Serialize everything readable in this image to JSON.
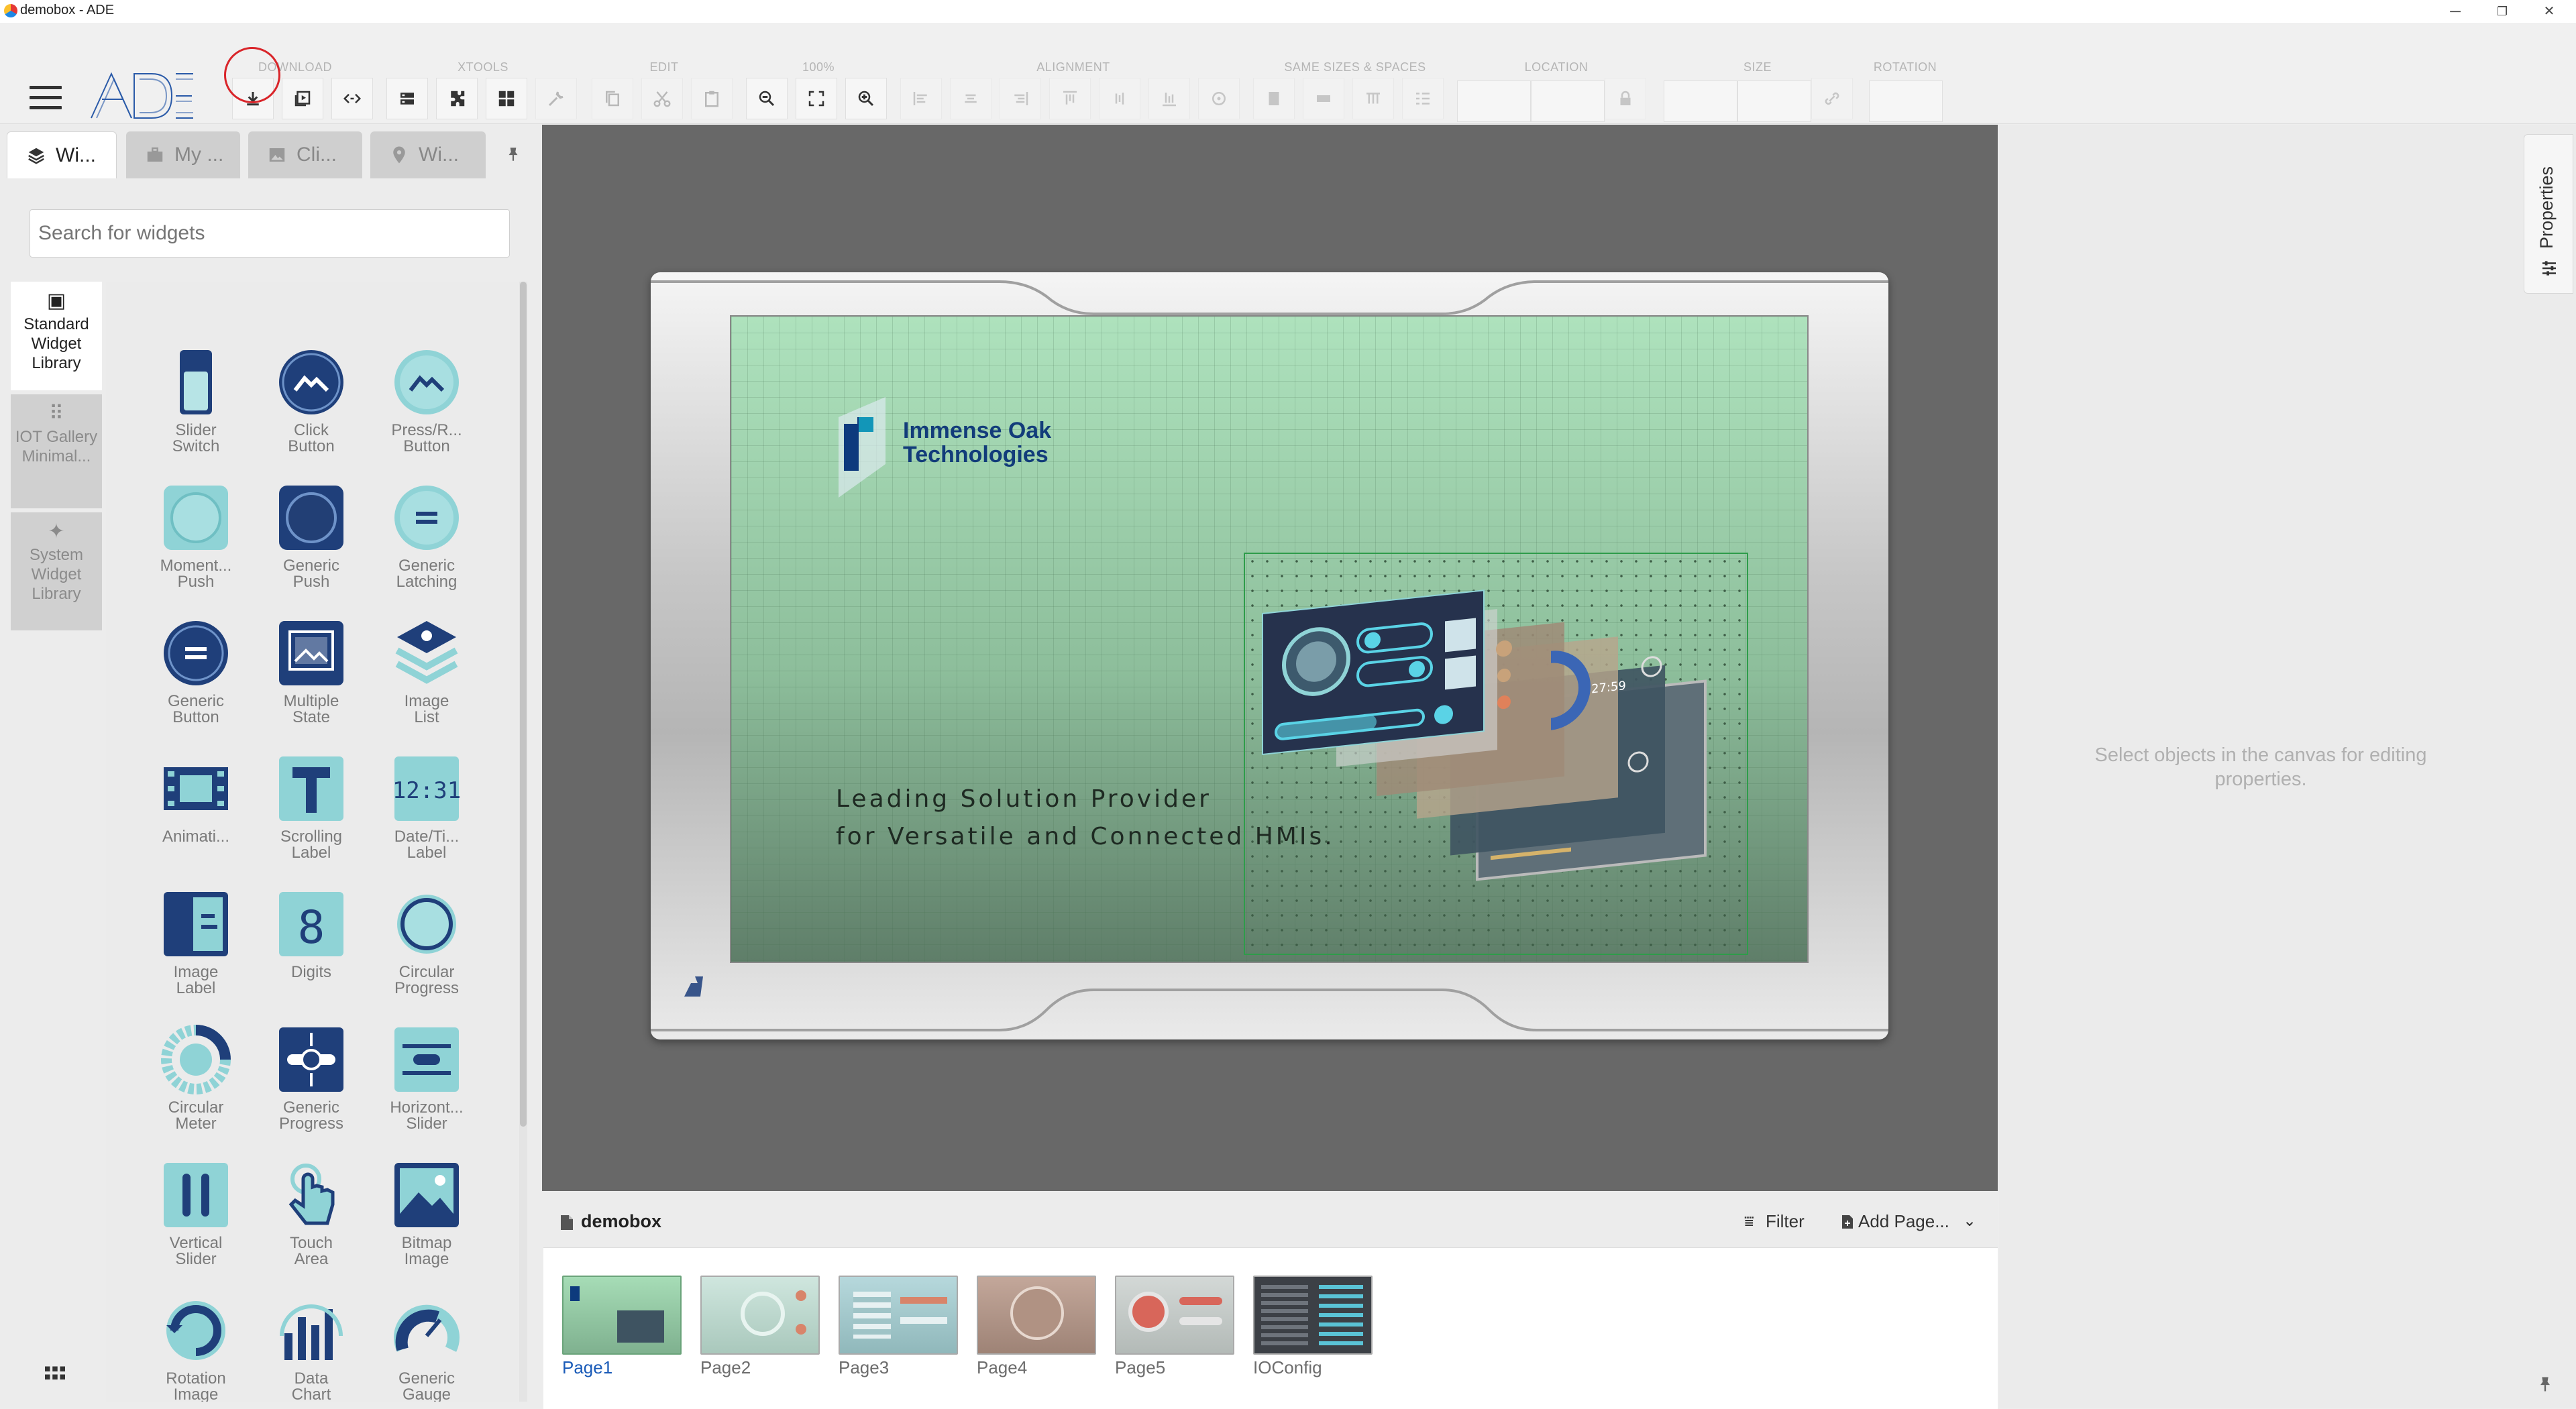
{
  "window": {
    "title": "demobox - ADE",
    "minimize": "─",
    "restore": "❐",
    "close": "✕"
  },
  "toolbar": {
    "groups": [
      "DOWNLOAD",
      "XTOOLS",
      "EDIT",
      "100%",
      "ALIGNMENT",
      "SAME SIZES & SPACES",
      "LOCATION",
      "SIZE",
      "ROTATION"
    ]
  },
  "left_panel": {
    "tabs": [
      {
        "label": "Wi...",
        "icon": "layers-icon"
      },
      {
        "label": "My ...",
        "icon": "briefcase-icon"
      },
      {
        "label": "Cli...",
        "icon": "image-icon"
      },
      {
        "label": "Wi...",
        "icon": "map-pin-icon"
      }
    ],
    "search_placeholder": "Search for widgets",
    "libraries": [
      "Standard Widget Library",
      "IOT Gallery Minimal...",
      "System Widget Library"
    ],
    "widgets": [
      "Slider Switch",
      "Click Button",
      "Press/R... Button",
      "Moment... Push",
      "Generic Push",
      "Generic Latching",
      "Generic Button",
      "Multiple State",
      "Image List",
      "Animati...",
      "Scrolling Label",
      "Date/Ti... Label",
      "Image Label",
      "Digits",
      "Circular Progress",
      "Circular Meter",
      "Generic Progress",
      "Horizont... Slider",
      "Vertical Slider",
      "Touch Area",
      "Bitmap Image",
      "Rotation Image",
      "Data Chart",
      "Generic Gauge"
    ]
  },
  "canvas": {
    "company_line1": "Immense Oak",
    "company_line2": "Technologies",
    "tagline_line1": "Leading Solution Provider",
    "tagline_line2": "for Versatile and Connected HMIs."
  },
  "page_strip": {
    "project": "demobox",
    "filter_label": "Filter",
    "add_page_label": "Add Page...",
    "pages": [
      "Page1",
      "Page2",
      "Page3",
      "Page4",
      "Page5",
      "IOConfig"
    ],
    "active_page": "Page1"
  },
  "properties": {
    "tab_label": "Properties",
    "empty_message": "Select objects in the canvas for editing properties."
  },
  "colors": {
    "accent": "#1a3c7a",
    "widget_teal": "#8fd3d6",
    "widget_navy": "#1f3f7a",
    "highlight": "#d9252a",
    "selection": "#2e9c4a"
  }
}
